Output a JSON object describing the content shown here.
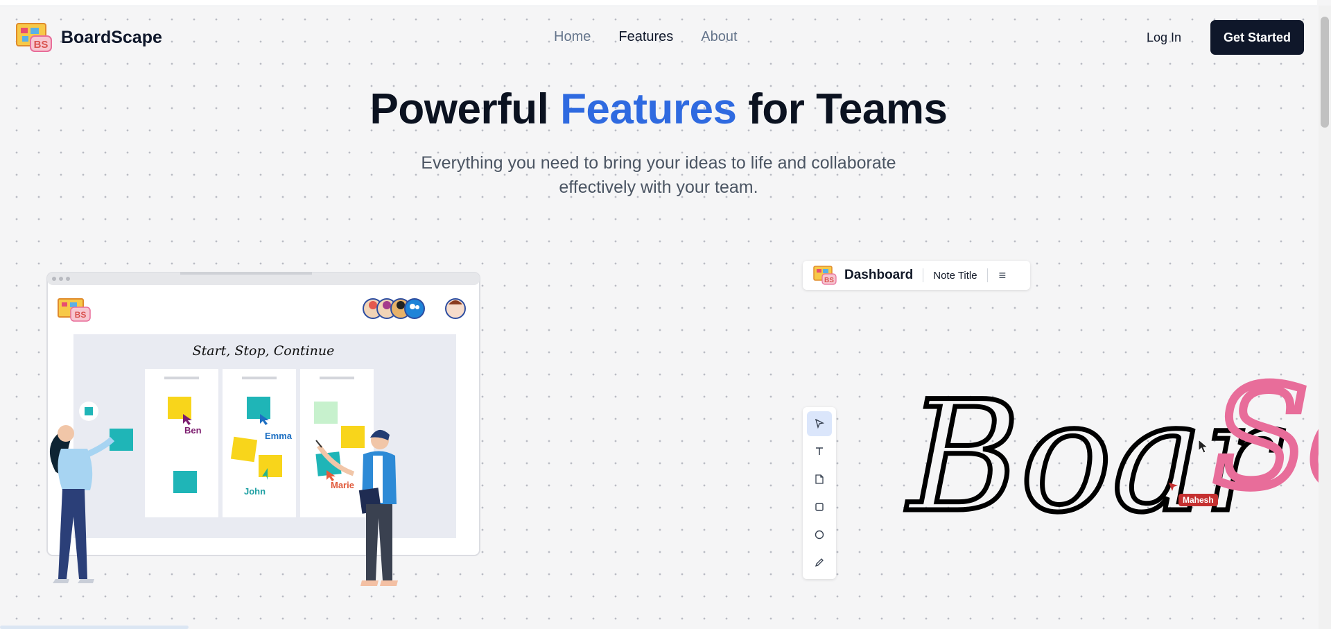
{
  "brand": {
    "name": "BoardScape",
    "logo_letters": "BS"
  },
  "nav": {
    "items": [
      {
        "label": "Home",
        "active": false
      },
      {
        "label": "Features",
        "active": true
      },
      {
        "label": "About",
        "active": false
      }
    ],
    "login_label": "Log In",
    "cta_label": "Get Started"
  },
  "hero": {
    "title_part1": "Powerful ",
    "title_highlight": "Features",
    "title_part2": " for Teams",
    "subtitle": "Everything you need to bring your ideas to life and collaborate effectively with your team."
  },
  "illustration": {
    "board_title": "Start, Stop, Continue",
    "cursors": [
      "Ben",
      "Emma",
      "John",
      "Marie"
    ]
  },
  "dashboard": {
    "title": "Dashboard",
    "note_title": "Note Title",
    "menu_icon": "menu-icon",
    "tools": [
      "pointer-icon",
      "text-icon",
      "note-icon",
      "square-icon",
      "circle-icon",
      "pencil-icon"
    ],
    "canvas_text": "BoardSc",
    "collaborator": "Mahesh"
  },
  "colors": {
    "accent": "#2f6ae0",
    "dark": "#0f172a",
    "collaborator": "#c53030",
    "pink_stroke": "#e86d9a"
  }
}
